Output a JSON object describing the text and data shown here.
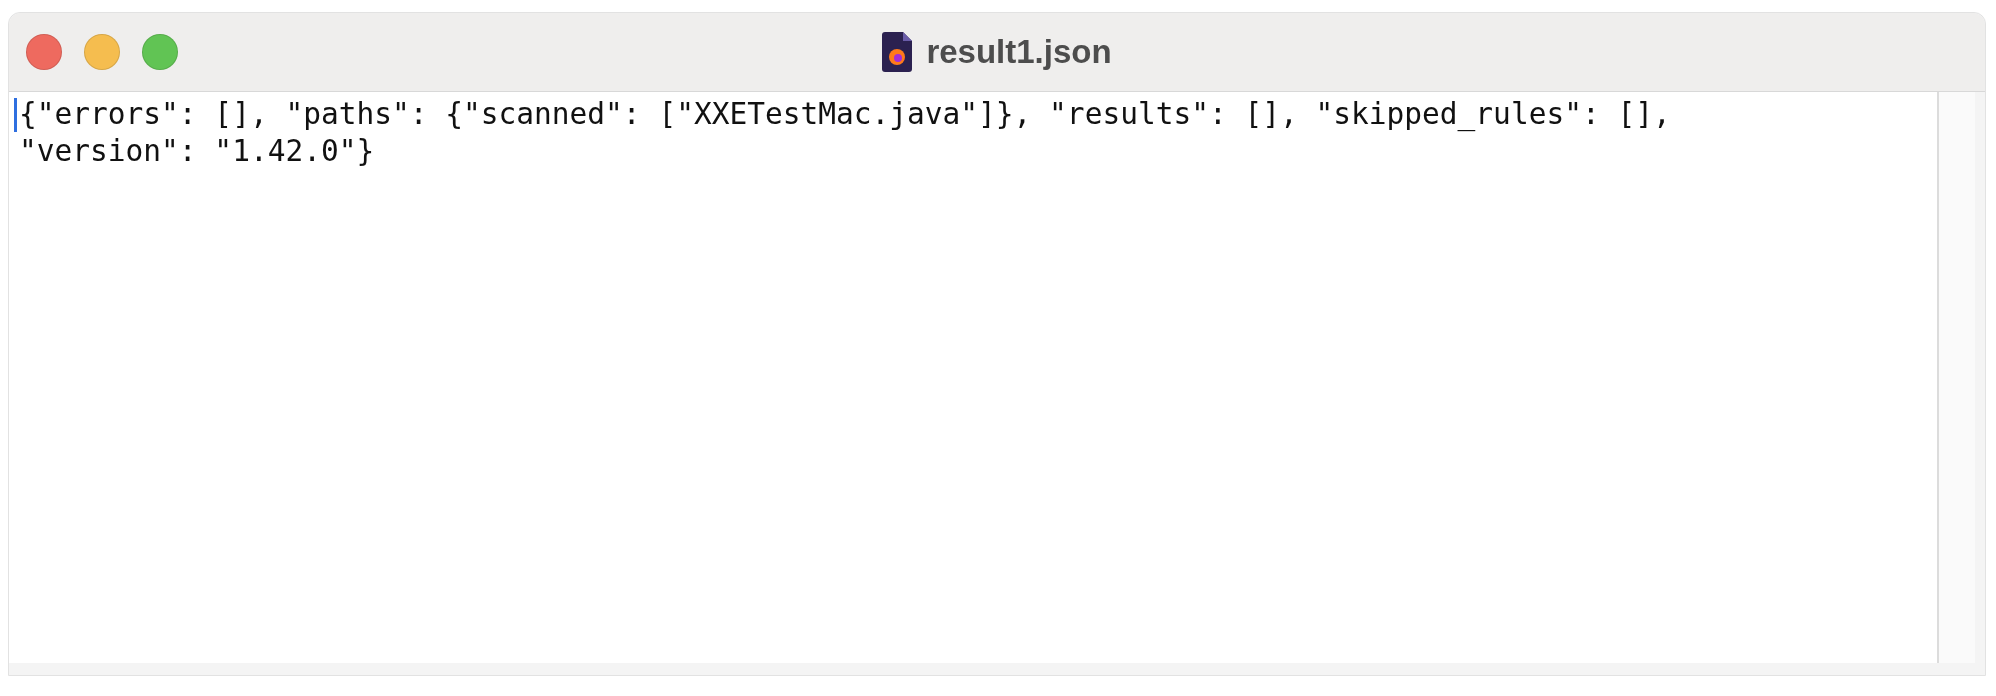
{
  "window": {
    "title": "result1.json"
  },
  "editor": {
    "lines": [
      "{\"errors\": [], \"paths\": {\"scanned\": [\"XXETestMac.java\"]}, \"results\": [], \"skipped_rules\": [],",
      "\"version\": \"1.42.0\"}"
    ]
  }
}
